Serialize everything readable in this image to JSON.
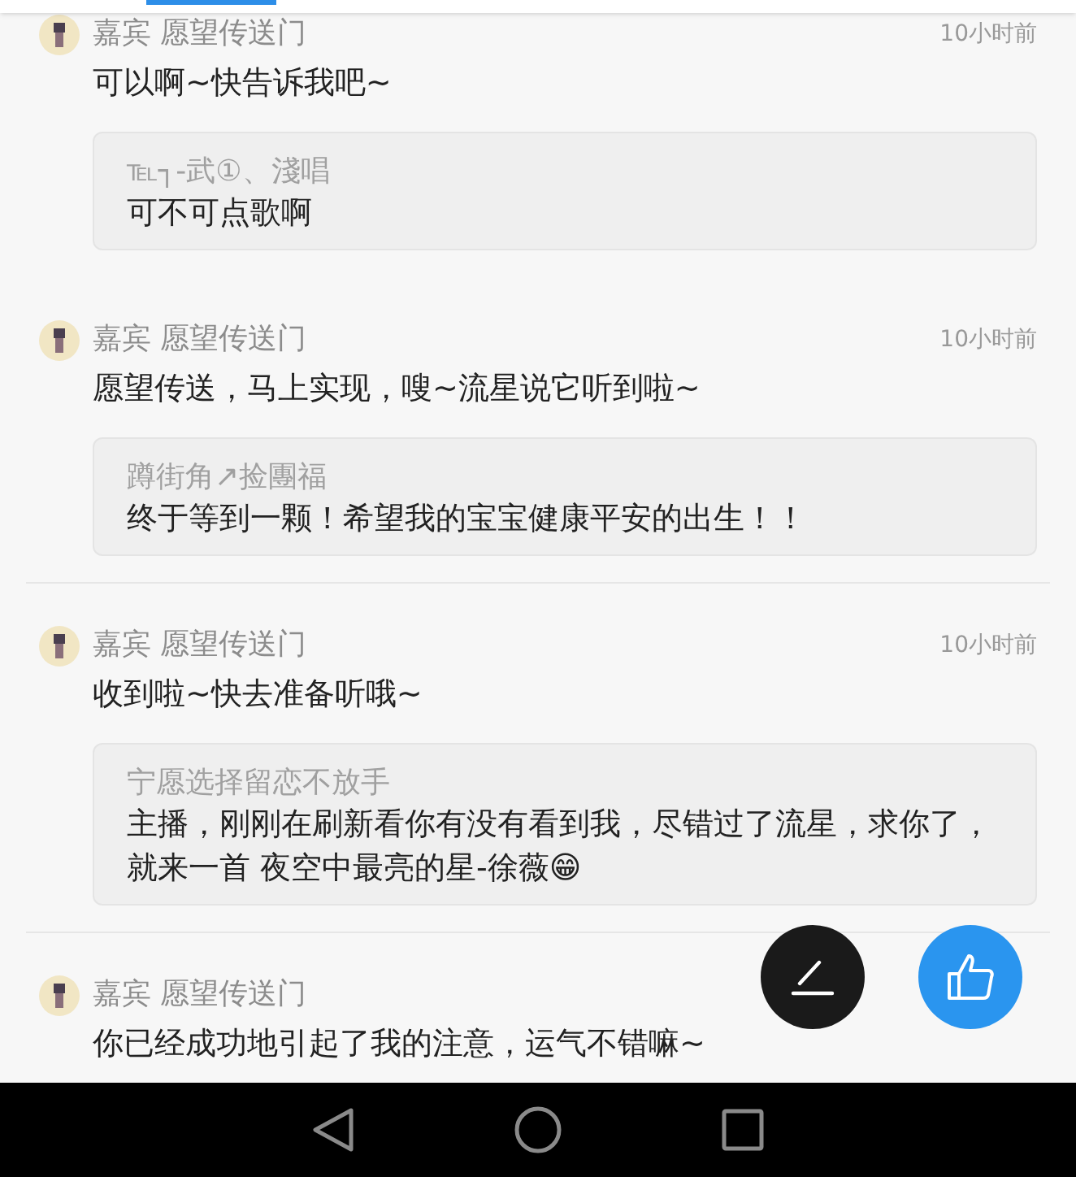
{
  "comments": [
    {
      "author": "嘉宾 愿望传送门",
      "time": "10小时前",
      "message": "可以啊~快告诉我吧~",
      "divider_above": false,
      "quote": {
        "author": "℡┐-武①、淺唱",
        "text": "可不可点歌啊"
      }
    },
    {
      "author": "嘉宾 愿望传送门",
      "time": "10小时前",
      "message": "愿望传送，马上实现，嗖~流星说它听到啦~",
      "divider_above": false,
      "quote": {
        "author": "蹲街角↗捡團福",
        "text": "终于等到一颗！希望我的宝宝健康平安的出生！！"
      }
    },
    {
      "author": "嘉宾 愿望传送门",
      "time": "10小时前",
      "message": "收到啦~快去准备听哦~",
      "divider_above": true,
      "quote": {
        "author": "宁愿选择留恋不放手",
        "text": "主播，刚刚在刷新看你有没有看到我，尽错过了流星，求你了，就来一首 夜空中最亮的星-徐薇😁"
      }
    },
    {
      "author": "嘉宾 愿望传送门",
      "message": "你已经成功地引起了我的注意，运气不错嘛~",
      "divider_above": true
    }
  ]
}
